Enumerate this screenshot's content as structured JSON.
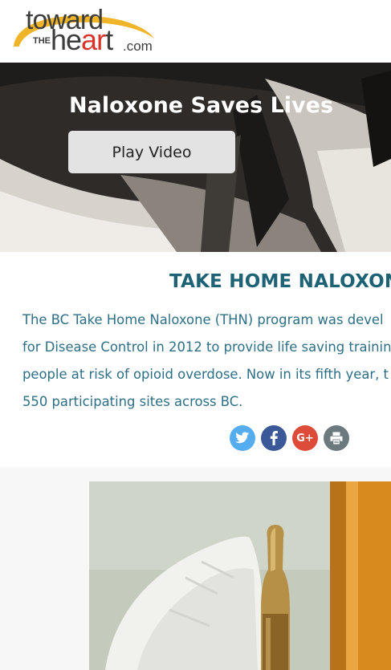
{
  "header": {
    "logo": {
      "word1": "toward",
      "word2": "THE",
      "word3_pre": "he",
      "word3_accent": "ar",
      "word3_post": "t",
      "word4": ".com",
      "icon": "swoosh-logo"
    }
  },
  "hero": {
    "title": "Naloxone Saves Lives",
    "play_button_label": "Play Video"
  },
  "content": {
    "title": "TAKE HOME NALOXON",
    "body_lines": [
      "The BC Take Home Naloxone (THN) program was devel",
      "for Disease Control in 2012 to provide life saving trainin",
      "people at risk of opioid overdose. Now in its fifth year, t",
      "550 participating sites across BC."
    ],
    "share": [
      {
        "icon": "twitter-icon",
        "color": "#55acee"
      },
      {
        "icon": "facebook-icon",
        "color": "#3b5998"
      },
      {
        "icon": "google-plus-icon",
        "color": "#dd4b39",
        "label": "G+"
      },
      {
        "icon": "print-icon",
        "color": "#6c7a7d"
      }
    ]
  },
  "colors": {
    "title": "#1e6276",
    "body": "#2e6f86",
    "logo_accent": "#d9342b",
    "logo_swoosh": "#f0b428"
  }
}
